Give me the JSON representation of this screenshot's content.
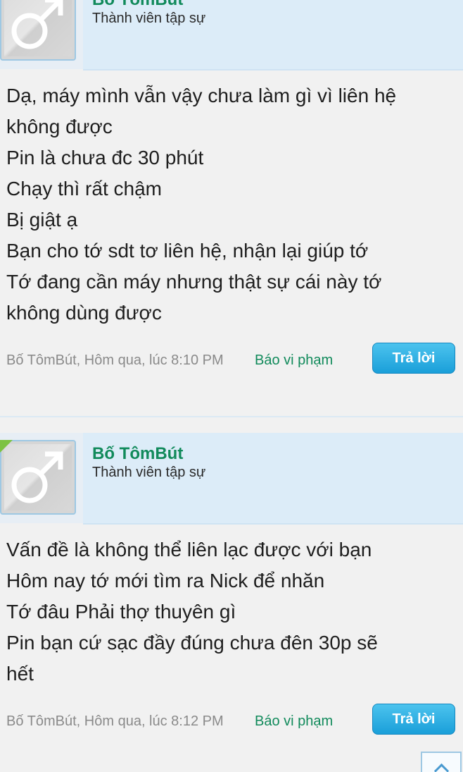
{
  "posts": [
    {
      "username": "Bố TômBút",
      "user_title": "Thành viên tập sự",
      "lines": [
        "Dạ, máy mình vẫn vậy chưa làm gì vì liên hệ",
        "không được",
        "Pin là chưa đc 30 phút",
        "Chạy thì rất chậm",
        "Bị giật ạ",
        "Bạn cho tớ sdt tơ liên hệ, nhận lại giúp tớ",
        "Tớ đang cần máy nhưng thật sự cái này tớ",
        "không dùng được"
      ],
      "meta": "Bố TômBút, Hôm qua, lúc 8:10 PM",
      "report_label": "Báo vi phạm",
      "reply_label": "Trả lời"
    },
    {
      "username": "Bố TômBút",
      "user_title": "Thành viên tập sự",
      "lines": [
        "Vấn đề là không thể liên lạc được với bạn",
        "Hôm nay tớ mới tìm ra Nick để nhăn",
        "Tớ đâu Phải thợ thuyên gì",
        "Pin bạn cứ sạc đầy đúng chưa đên 30p sẽ",
        "hết"
      ],
      "meta": "Bố TômBút, Hôm qua, lúc 8:12 PM",
      "report_label": "Báo vi phạm",
      "reply_label": "Trả lời"
    }
  ],
  "colors": {
    "accent_green": "#118a5b",
    "reply_blue": "#1a9fd9",
    "header_bg": "#dcecf8"
  },
  "icons": {
    "avatar": "male-symbol-icon",
    "scroll_top": "chevron-up-icon"
  }
}
